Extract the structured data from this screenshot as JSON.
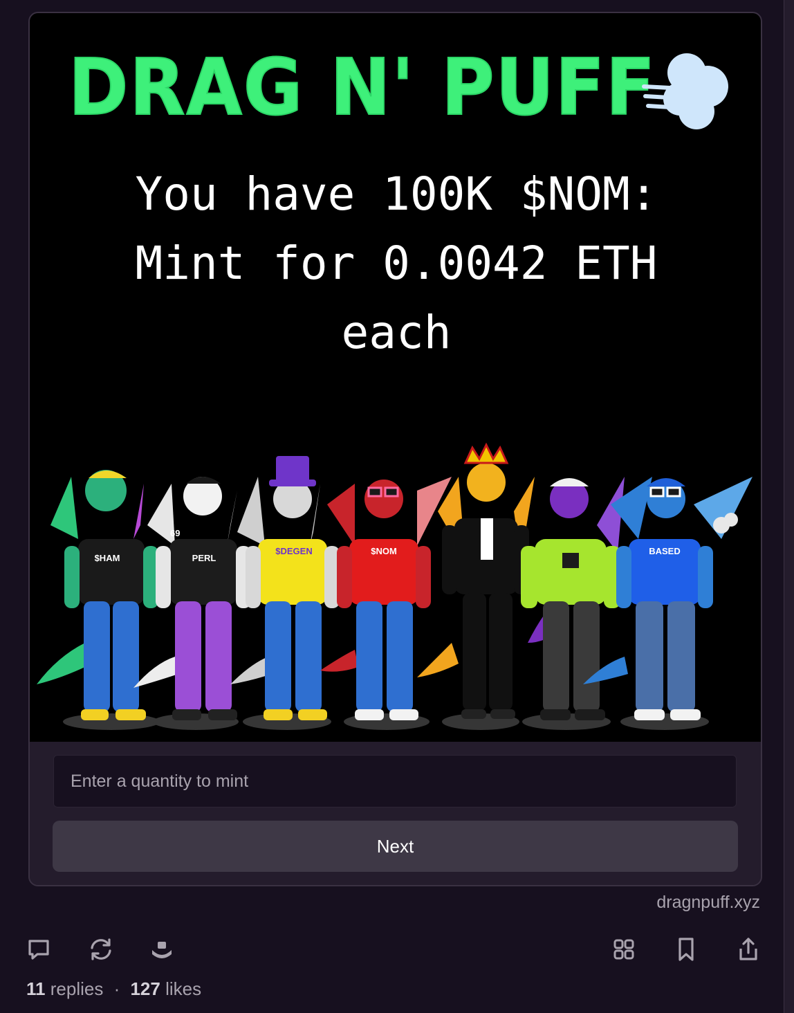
{
  "frame": {
    "logo_text": "DRAG N' PUFF",
    "headline": [
      "You have 100K $NOM:",
      "Mint for 0.0042 ETH",
      "each"
    ],
    "shirt_labels": [
      "$HAM",
      "PERL",
      "$DEGEN",
      "$NOM",
      "",
      "",
      "BASED"
    ],
    "jersey_number": "69",
    "input": {
      "placeholder": "Enter a quantity to mint",
      "value": ""
    },
    "button_label": "Next",
    "domain": "dragnpuff.xyz"
  },
  "actions": {
    "left": [
      "reply-icon",
      "recast-icon",
      "tip-icon"
    ],
    "right": [
      "grid-icon",
      "bookmark-icon",
      "share-icon"
    ]
  },
  "stats": {
    "replies_count": "11",
    "replies_label": "replies",
    "separator": "·",
    "likes_count": "127",
    "likes_label": "likes"
  },
  "colors": {
    "background": "#17101f",
    "card": "#241c2c",
    "logo_green": "#3ef07a",
    "puff_blue": "#cfe6fb",
    "muted_text": "#a9a3ae"
  }
}
